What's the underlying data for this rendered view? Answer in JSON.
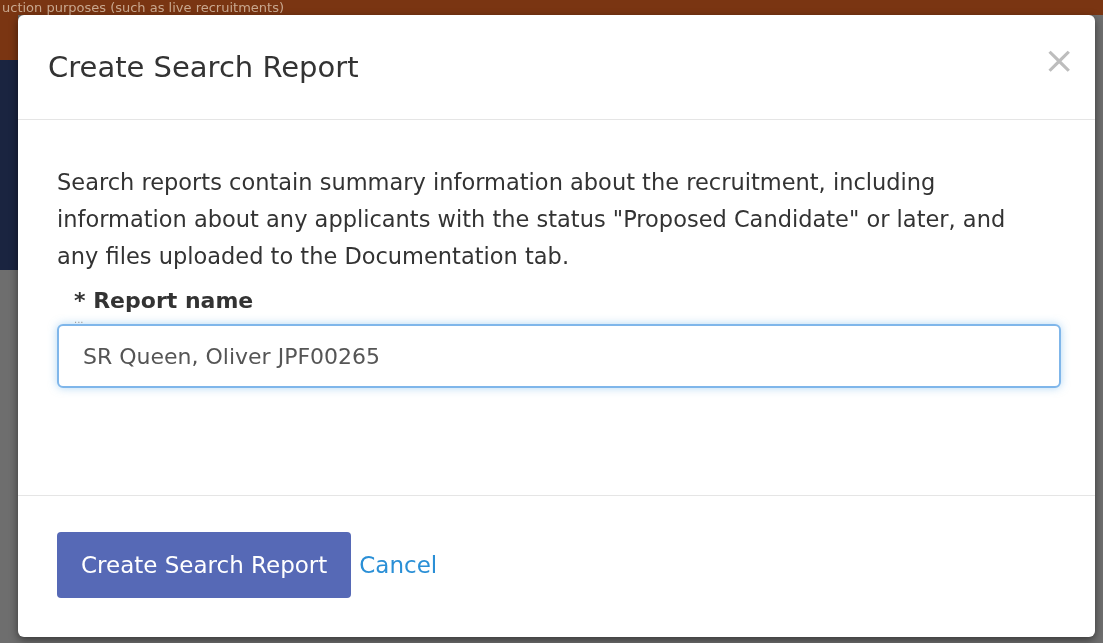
{
  "background": {
    "banner_text": "uction purposes (such as live recruitments)"
  },
  "dialog": {
    "title": "Create Search Report",
    "close": "×",
    "description": "Search reports contain summary information about the recruitment, including information about any applicants with the status \"Proposed Candidate\" or later, and any files uploaded to the Documentation tab.",
    "field": {
      "label": "* Report name",
      "hint": "...",
      "value": "SR Queen, Oliver JPF00265",
      "focused": true
    },
    "buttons": [
      {
        "label": "Create Search Report",
        "kind": "primary"
      },
      {
        "label": "Cancel",
        "kind": "link"
      }
    ]
  }
}
